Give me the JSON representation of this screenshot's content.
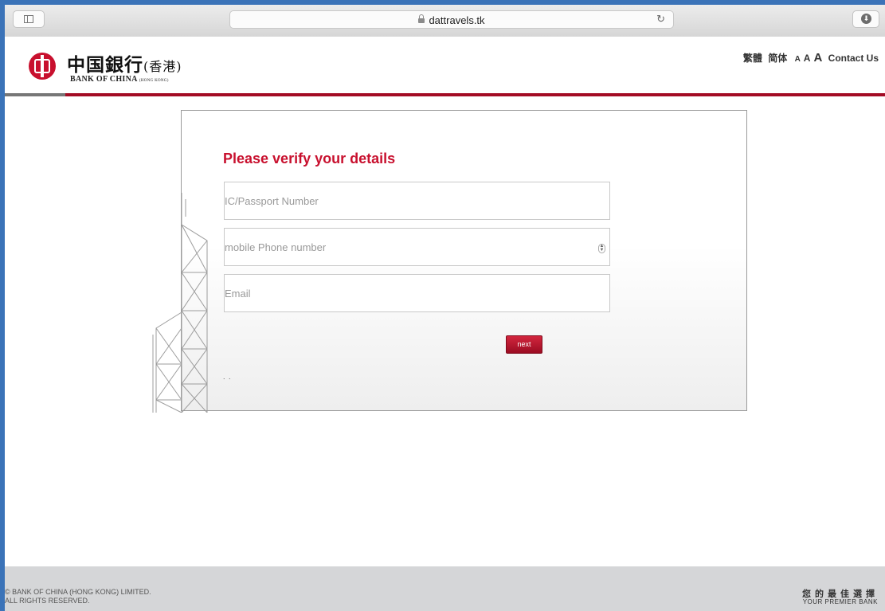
{
  "browser": {
    "url": "dattravels.tk",
    "reload_icon": "↻",
    "download_icon": "⬇"
  },
  "header": {
    "logo_cn": "中国銀行",
    "logo_cn_hk": "(香港)",
    "logo_en": "BANK OF CHINA",
    "logo_en_small": "(HONG KONG)",
    "lang_traditional": "繁體",
    "lang_simplified": "简体",
    "font_small": "A",
    "font_medium": "A",
    "font_large": "A",
    "contact_us": "Contact Us"
  },
  "form": {
    "title": "Please verify your details",
    "fields": [
      {
        "placeholder": "IC/Passport Number",
        "value": ""
      },
      {
        "placeholder": "mobile Phone number",
        "value": ""
      },
      {
        "placeholder": "Email",
        "value": ""
      }
    ],
    "next_label": "next",
    "dots": ". ."
  },
  "footer": {
    "copyright_line1": "© BANK OF CHINA (HONG KONG) LIMITED.",
    "copyright_line2": "ALL RIGHTS RESERVED.",
    "slogan_cn": "您的最佳選擇",
    "slogan_en": "YOUR PREMIER BANK"
  },
  "colors": {
    "brand_red": "#c8102e",
    "page_frame": "#3b73b8",
    "footer_bg": "#d5d6d8"
  }
}
